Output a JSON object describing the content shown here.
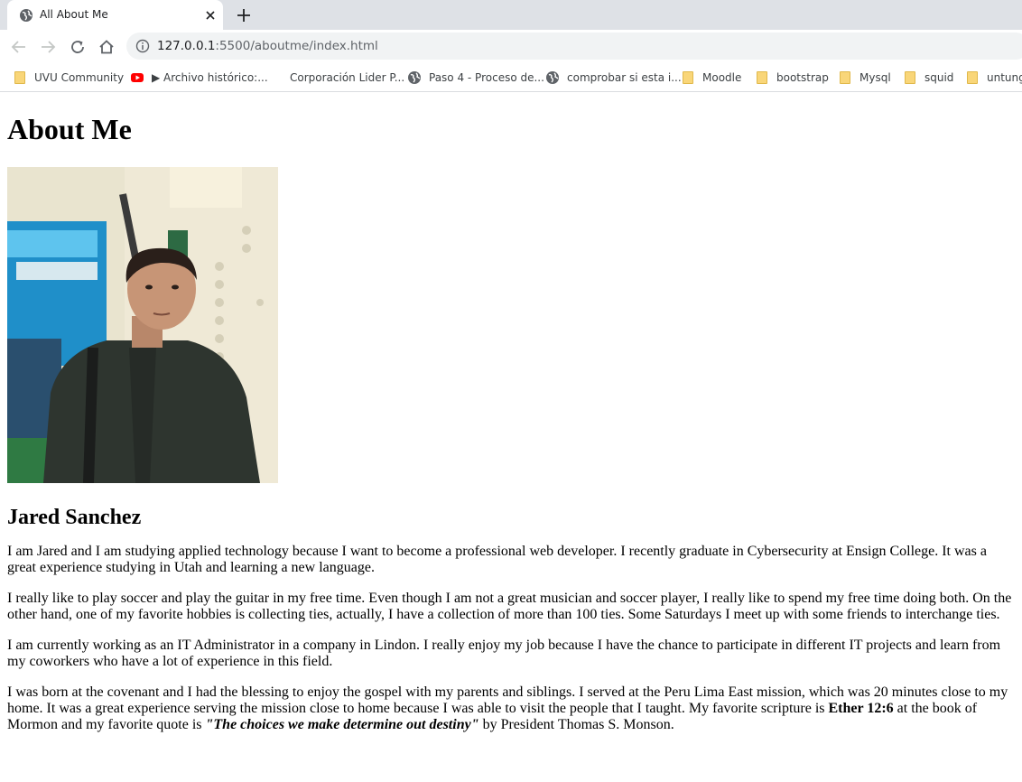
{
  "browser": {
    "tab_title": "All About Me",
    "url_host": "127.0.0.1",
    "url_path": ":5500/aboutme/index.html",
    "bookmarks": [
      {
        "label": "UVU Community",
        "icon": "folder-icon"
      },
      {
        "label": "▶ Archivo histórico:...",
        "icon": "youtube-icon"
      },
      {
        "label": "Corporación Lider P...",
        "icon": "none"
      },
      {
        "label": "Paso 4 - Proceso de...",
        "icon": "globe-icon"
      },
      {
        "label": "comprobar si esta i...",
        "icon": "globe-icon"
      },
      {
        "label": "Moodle",
        "icon": "folder-icon"
      },
      {
        "label": "bootstrap",
        "icon": "folder-icon"
      },
      {
        "label": "Mysql",
        "icon": "folder-icon"
      },
      {
        "label": "squid",
        "icon": "folder-icon"
      },
      {
        "label": "untung",
        "icon": "folder-icon"
      }
    ]
  },
  "page": {
    "heading": "About Me",
    "name": "Jared Sanchez",
    "paragraphs": {
      "p1": "I am Jared and I am studying applied technology because I want to become a professional web developer. I recently graduate in Cybersecurity at Ensign College. It was a great experience studying in Utah and learning a new language.",
      "p2": "I really like to play soccer and play the guitar in my free time. Even though I am not a great musician and soccer player, I really like to spend my free time doing both. On the other hand, one of my favorite hobbies is collecting ties, actually, I have a collection of more than 100 ties. Some Saturdays I meet up with some friends to interchange ties.",
      "p3": "I am currently working as an IT Administrator in a company in Lindon. I really enjoy my job because I have the chance to participate in different IT projects and learn from my coworkers who have a lot of experience in this field.",
      "p4_a": "I was born at the covenant and I had the blessing to enjoy the gospel with my parents and siblings. I served at the Peru Lima East mission, which was 20 minutes close to my home. It was a great experience serving the mission close to home because I was able to visit the people that I taught. My favorite scripture is ",
      "p4_scripture": "Ether 12:6",
      "p4_b": " at the book of Mormon and my favorite quote is ",
      "p4_quote": "\"The choices we make determine out destiny\"",
      "p4_c": " by President Thomas S. Monson."
    }
  },
  "colors": {
    "tabbar_bg": "#dee1e6",
    "omnibox_bg": "#f1f3f4",
    "folder": "#f9d679"
  }
}
